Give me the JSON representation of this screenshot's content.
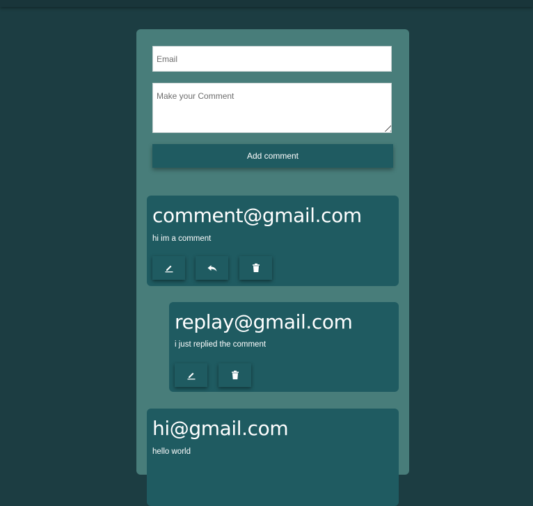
{
  "form": {
    "email_placeholder": "Email",
    "comment_placeholder": "Make your Comment",
    "submit_label": "Add comment"
  },
  "comments": [
    {
      "email": "comment@gmail.com",
      "text": "hi im a comment"
    },
    {
      "email": "replay@gmail.com",
      "text": "i just replied the comment"
    },
    {
      "email": "hi@gmail.com",
      "text": "hello world"
    }
  ],
  "icons": {
    "edit": "pencil-icon",
    "reply": "reply-icon",
    "delete": "trash-icon"
  },
  "colors": {
    "background": "#1c3d42",
    "panel": "#487d7a",
    "card": "#1f5b61",
    "text": "#ffffff"
  }
}
